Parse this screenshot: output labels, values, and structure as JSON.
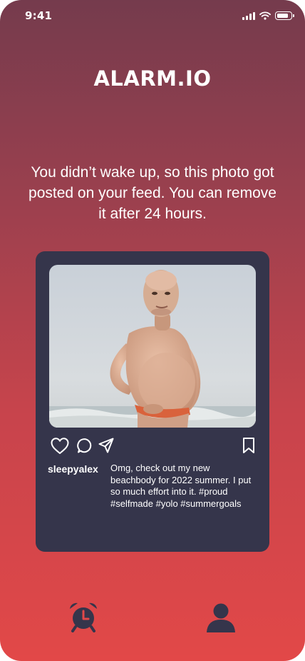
{
  "status_bar": {
    "time": "9:41"
  },
  "app": {
    "title": "ALARM.IO"
  },
  "message": "You didn’t wake up, so this photo got posted on your feed. You can remove it after 24 hours.",
  "post": {
    "username": "sleepyalex",
    "caption": "Omg, check out my new beachbody for 2022 summer. I put so much effort into it. #proud #selfmade #yolo #summergoals",
    "actions": [
      "heart-icon",
      "comment-icon",
      "share-icon",
      "bookmark-icon"
    ]
  },
  "bottom_nav": {
    "items": [
      "alarm-clock-icon",
      "profile-icon"
    ],
    "icon_color": "#35354b"
  },
  "colors": {
    "gradient_top": "#753b4d",
    "gradient_bottom": "#e24848",
    "card": "#35354b",
    "text": "#ffffff"
  }
}
